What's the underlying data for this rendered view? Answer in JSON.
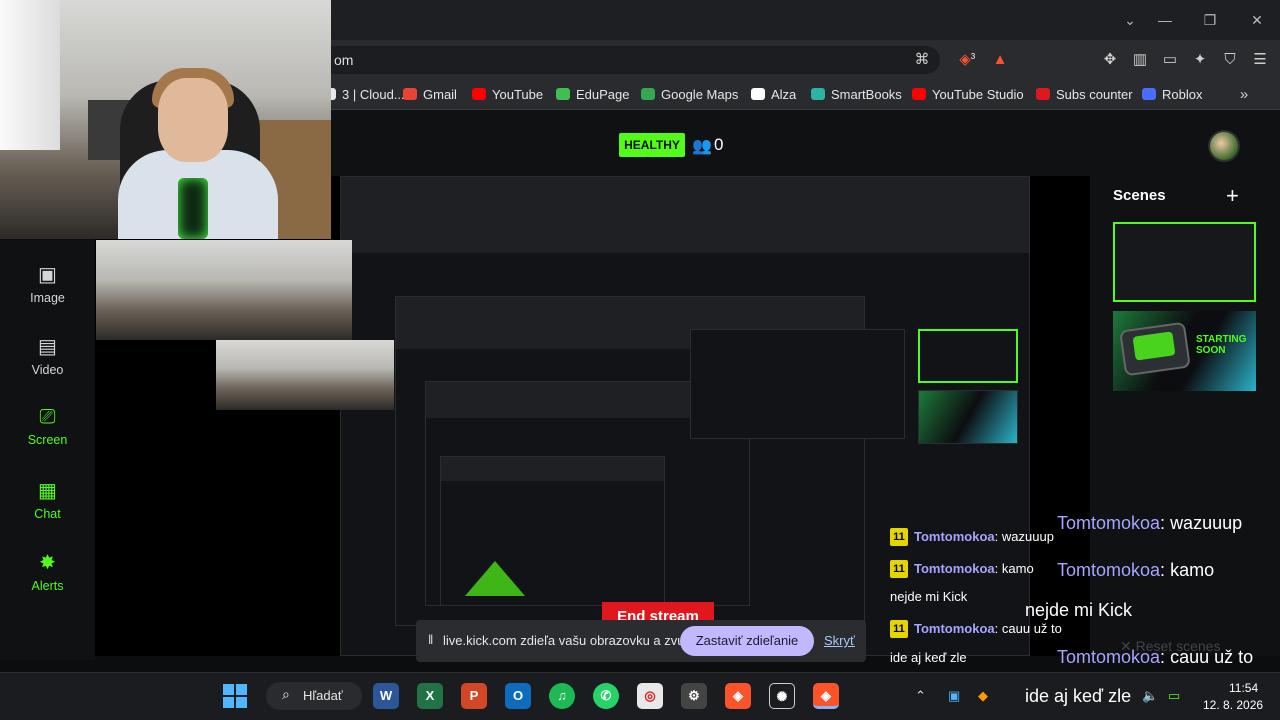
{
  "browser": {
    "url": "om",
    "bookmarks": [
      {
        "label": "3 | Cloud...",
        "color": "#e8e8e8"
      },
      {
        "label": "Gmail",
        "color": "#ea4335"
      },
      {
        "label": "YouTube",
        "color": "#ff0000"
      },
      {
        "label": "EduPage",
        "color": "#3fbf52"
      },
      {
        "label": "Google Maps",
        "color": "#34a853"
      },
      {
        "label": "Alza",
        "color": "#ffffff"
      },
      {
        "label": "SmartBooks",
        "color": "#2bb3a3"
      },
      {
        "label": "YouTube Studio",
        "color": "#ff0000"
      },
      {
        "label": "Subs counter",
        "color": "#e0181e"
      },
      {
        "label": "Roblox",
        "color": "#4a6cff"
      }
    ],
    "brave_badge": "3"
  },
  "stream": {
    "status": "HEALTHY",
    "viewers": "0"
  },
  "sidebar": {
    "items": [
      {
        "label": "Image",
        "icon": "image-icon"
      },
      {
        "label": "Video",
        "icon": "video-icon"
      },
      {
        "label": "Screen",
        "icon": "screen-icon"
      },
      {
        "label": "Chat",
        "icon": "chat-icon"
      },
      {
        "label": "Alerts",
        "icon": "alerts-icon"
      }
    ]
  },
  "scenes": {
    "title": "Scenes",
    "add": "+",
    "starting_soon": "STARTING SOON"
  },
  "chat": {
    "badge": "11",
    "messages": [
      {
        "user": "Tomtomokoa",
        "text": "wazuuup"
      },
      {
        "user": "Tomtomokoa",
        "text": "kamo"
      },
      {
        "user": "",
        "text": "nejde mi Kick"
      },
      {
        "user": "Tomtomokoa",
        "text": "cauu už to"
      },
      {
        "user": "",
        "text": "ide aj keď zle"
      }
    ]
  },
  "controls": {
    "end_stream": "End stream",
    "reset_scenes": "Reset scenes"
  },
  "share_notice": {
    "text": "live.kick.com zdieľa vašu obrazovku a zvuk.",
    "stop_label": "Zastaviť zdieľanie",
    "hide_label": "Skryť"
  },
  "taskbar": {
    "search_label": "Hľadať",
    "time": "11:54",
    "date": "12. 8. 2026"
  },
  "colors": {
    "accent": "#53fc18",
    "chat_name": "#a8a4ff",
    "danger": "#e0181e"
  }
}
